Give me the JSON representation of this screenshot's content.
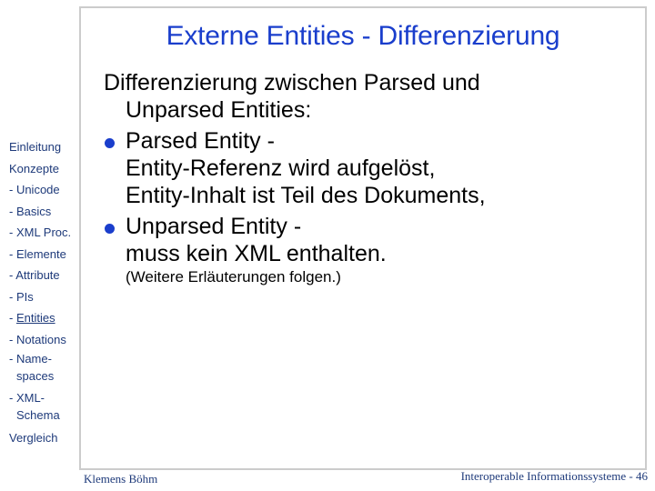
{
  "slide": {
    "title": "Externe Entities - Differenzierung",
    "intro_line1": "Differenzierung zwischen Parsed und",
    "intro_line2": "Unparsed Entities:",
    "bullets": [
      {
        "lines": [
          "Parsed Entity -",
          "Entity-Referenz wird aufgelöst,",
          "Entity-Inhalt ist Teil des Dokuments,"
        ]
      },
      {
        "lines": [
          "Unparsed Entity -",
          "muss kein XML enthalten."
        ]
      }
    ],
    "note": "(Weitere Erläuterungen folgen.)",
    "accent_color": "#1a3ecc"
  },
  "sidebar": {
    "items": [
      {
        "label": "Einleitung"
      },
      {
        "label": "Konzepte"
      },
      {
        "label": "- Unicode"
      },
      {
        "label": "- Basics"
      },
      {
        "label": "- XML Proc."
      },
      {
        "label": "- Elemente"
      },
      {
        "label": "- Attribute"
      },
      {
        "label": "- PIs"
      },
      {
        "prefix": "- ",
        "label": "Entities",
        "active": true
      },
      {
        "label": "- Notations"
      },
      {
        "label": "- Name-",
        "cont": "spaces"
      },
      {
        "label": "- XML-",
        "cont": "Schema"
      },
      {
        "label": "Vergleich"
      }
    ]
  },
  "footer": {
    "author": "Klemens Böhm",
    "course": "Interoperable Informationssysteme - 46"
  }
}
